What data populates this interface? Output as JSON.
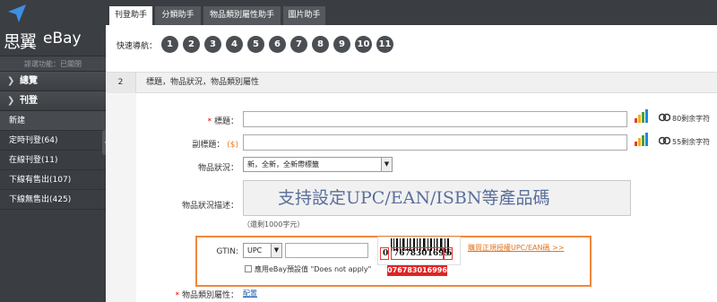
{
  "sidebar": {
    "brand_cn": "思翼",
    "brand_en": "eBay",
    "function_status": "誹選功能：已關閉",
    "sections": [
      {
        "label": "總覽"
      },
      {
        "label": "刊登"
      }
    ],
    "items": [
      {
        "label": "新建"
      },
      {
        "label": "定時刊登(64)"
      },
      {
        "label": "在線刊登(11)"
      },
      {
        "label": "下線有售出(107)"
      },
      {
        "label": "下線無售出(425)"
      }
    ]
  },
  "tabs": [
    {
      "label": "刊登助手",
      "active": true
    },
    {
      "label": "分類助手",
      "active": false
    },
    {
      "label": "物品類別屬性助手",
      "active": false
    },
    {
      "label": "圖片助手",
      "active": false
    }
  ],
  "quicknav": {
    "label": "快速導航：",
    "numbers": [
      "1",
      "2",
      "3",
      "4",
      "5",
      "6",
      "7",
      "8",
      "9",
      "10",
      "11"
    ]
  },
  "section": {
    "number": "2",
    "title": "標題，物品狀況，物品類別屬性"
  },
  "form": {
    "title_label": "標題：",
    "title_req": "*",
    "title_value": "",
    "title_remaining": "80剩余字符",
    "subtitle_label": "副標題：",
    "subtitle_fee": "($)",
    "subtitle_value": "",
    "subtitle_remaining": "55剩余字符",
    "condition_label": "物品狀況：",
    "condition_value": "新，全新，全新帶標籤",
    "condition_desc_label": "物品狀況描述：",
    "overlay_caption": "支持設定UPC/EAN/ISBN等產品碼",
    "desc_remaining": "（還剩1000字元）",
    "gtin_label": "GTIN:",
    "gtin_type": "UPC",
    "gtin_value": "",
    "gtin_default_checkbox": "應用eBay預設值 \"Does not apply\"",
    "barcode_left": "0",
    "barcode_middle": "7678301699",
    "barcode_right": "6",
    "barcode_full": "076783016996",
    "gtin_help_link": "購買正規授權UPC/EAN碼 >>",
    "category_attr_label": "物品類別屬性：",
    "category_attr_req": "*",
    "category_attr_link": "配置"
  },
  "colors": {
    "sidebar_bg": "#3a3d42",
    "accent_orange": "#f0883a",
    "badge_red": "#e02424"
  }
}
